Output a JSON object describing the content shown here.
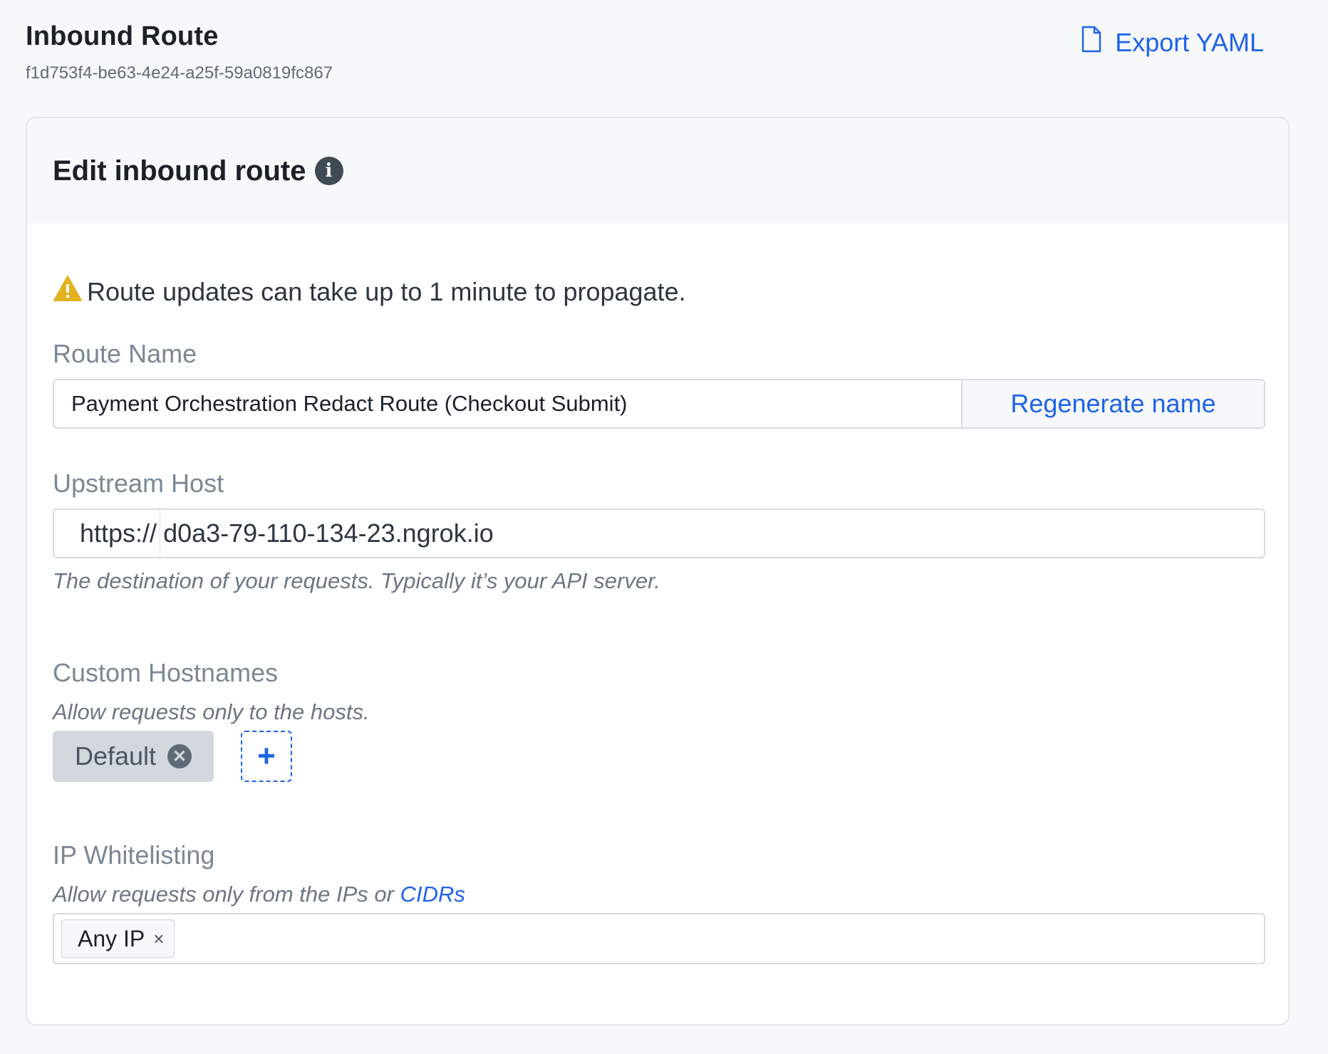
{
  "header": {
    "title": "Inbound Route",
    "id": "f1d753f4-be63-4e24-a25f-59a0819fc867",
    "export_label": "Export YAML"
  },
  "card": {
    "title": "Edit inbound route",
    "info_icon": "info-icon",
    "warning": "Route updates can take up to 1 minute to propagate.",
    "route_name": {
      "label": "Route Name",
      "value": "Payment Orchestration Redact Route (Checkout Submit)",
      "regenerate_label": "Regenerate name"
    },
    "upstream_host": {
      "label": "Upstream Host",
      "prefix": "https://",
      "value": "d0a3-79-110-134-23.ngrok.io",
      "help": "The destination of your requests. Typically it’s your API server."
    },
    "custom_hostnames": {
      "label": "Custom Hostnames",
      "help": "Allow requests only to the hosts.",
      "chips": [
        "Default"
      ],
      "add_label": "+"
    },
    "ip_whitelisting": {
      "label": "IP Whitelisting",
      "help_prefix": "Allow requests only from the IPs or ",
      "help_link": "CIDRs",
      "tags": [
        "Any IP"
      ],
      "tag_remove": "×"
    }
  },
  "colors": {
    "accent": "#1e63e9",
    "warning": "#e2b21f",
    "background": "#f7f8fa"
  }
}
